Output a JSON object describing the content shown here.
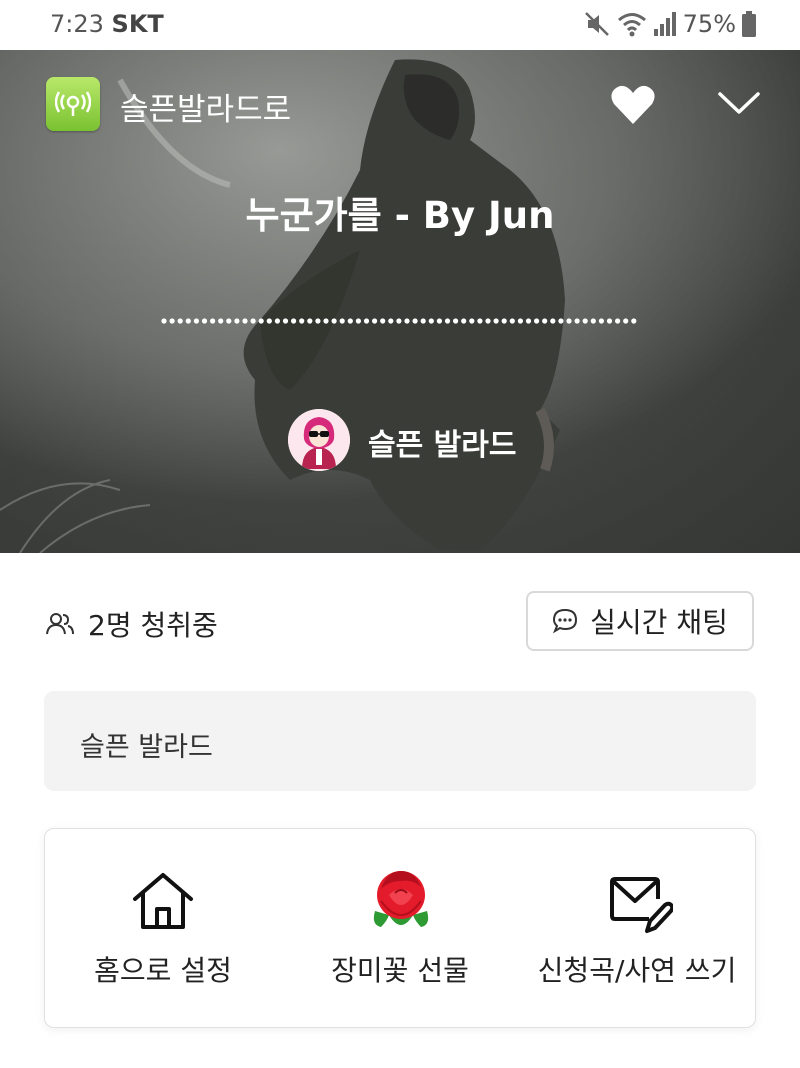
{
  "status_bar": {
    "time": "7:23",
    "carrier": "SKT",
    "battery": "75%",
    "icons": [
      "mute-icon",
      "wifi-icon",
      "signal-icon",
      "battery-icon"
    ]
  },
  "header": {
    "app_title": "슬픈발라드로",
    "app_icon": "radio-broadcast-icon",
    "favorite_icon": "heart-icon",
    "collapse_icon": "chevron-down-icon"
  },
  "player": {
    "song_title": "누군가를 - By Jun",
    "dj_name": "슬픈 발라드"
  },
  "info": {
    "listeners_text": "2명 청취중",
    "chat_button_label": "실시간 채팅"
  },
  "description": {
    "text": "슬픈 발라드"
  },
  "actions": [
    {
      "label": "홈으로 설정",
      "icon": "home-icon"
    },
    {
      "label": "장미꽃 선물",
      "icon": "rose-icon"
    },
    {
      "label": "신청곡/사연 쓰기",
      "icon": "mail-write-icon"
    }
  ],
  "colors": {
    "app_icon_green": "#8ccf3f",
    "dj_avatar_pink": "#d62b7a"
  }
}
